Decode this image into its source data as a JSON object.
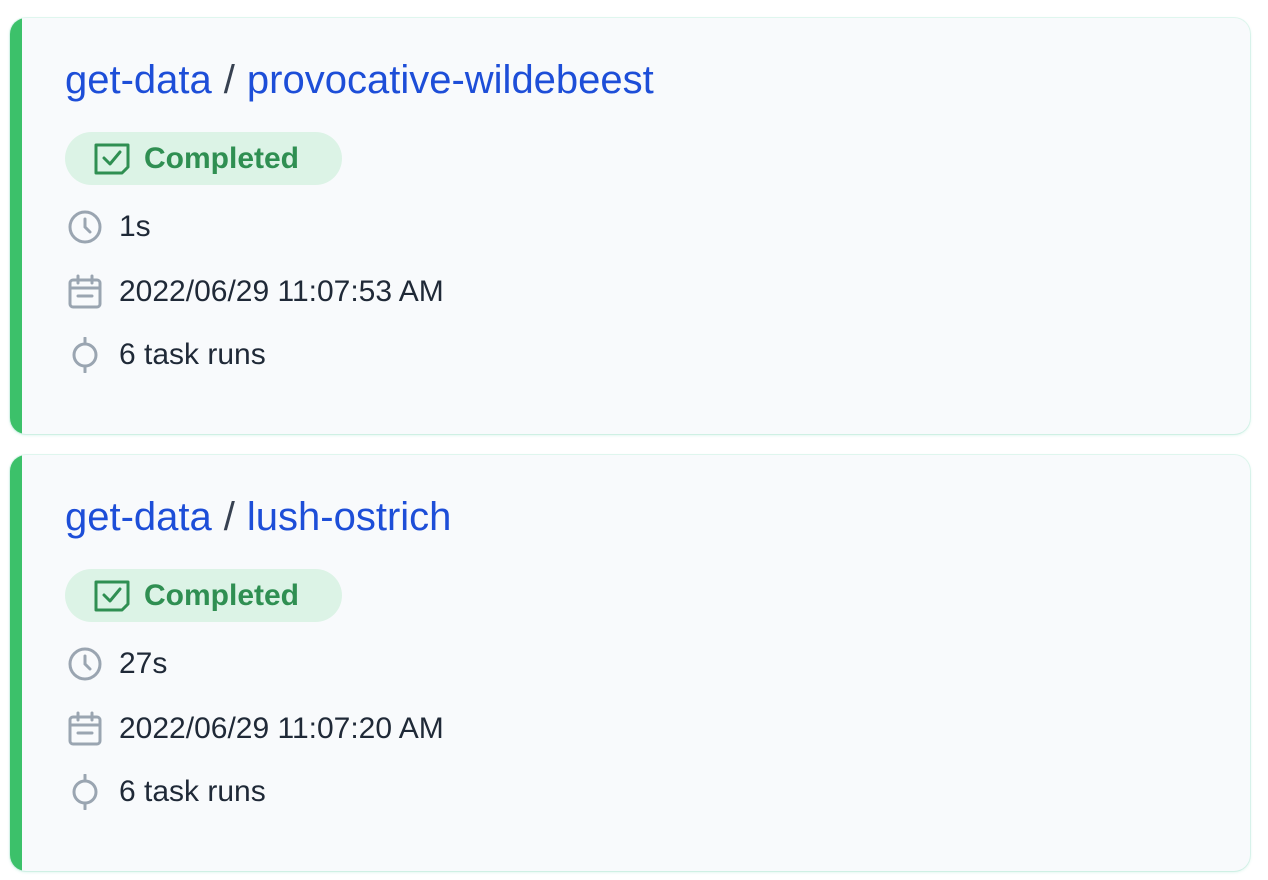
{
  "colors": {
    "accent_completed": "#3cc16a",
    "badge_bg": "#dcf3e6",
    "badge_text": "#2f8f52",
    "link": "#1d4ed8",
    "icon_gray": "#9aa5b1"
  },
  "runs": [
    {
      "flow_name": "get-data",
      "separator": "/",
      "run_name": "provocative-wildebeest",
      "state": "Completed",
      "duration": "1s",
      "start_time": "2022/06/29 11:07:53 AM",
      "task_runs": "6 task runs"
    },
    {
      "flow_name": "get-data",
      "separator": "/",
      "run_name": "lush-ostrich",
      "state": "Completed",
      "duration": "27s",
      "start_time": "2022/06/29 11:07:20 AM",
      "task_runs": "6 task runs"
    }
  ]
}
